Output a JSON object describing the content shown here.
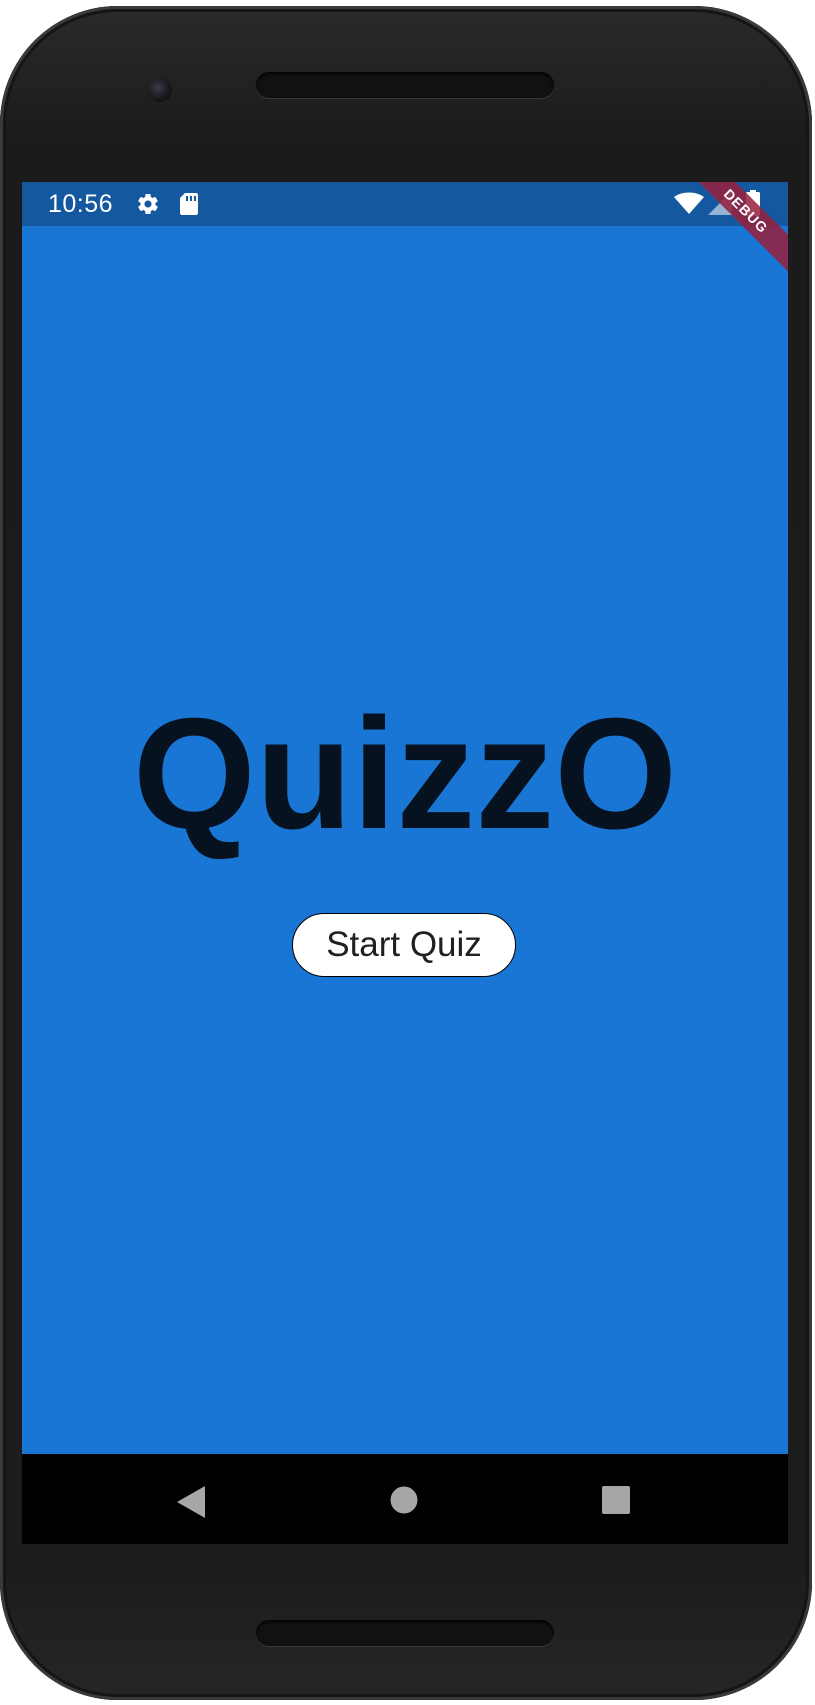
{
  "status_bar": {
    "time": "10:56",
    "icons": [
      "gear-icon",
      "sd-card-icon",
      "wifi-icon",
      "signal-icon",
      "battery-icon"
    ]
  },
  "debug_banner": {
    "label": "DEBUG"
  },
  "main": {
    "title": "QuizzO",
    "start_button_label": "Start Quiz"
  },
  "nav_bar": {
    "icons": [
      "back-icon",
      "home-icon",
      "recents-icon"
    ]
  },
  "colors": {
    "background": "#1976d4",
    "status_bar": "#1459a0",
    "title_text": "#06121f",
    "button_bg": "#ffffff",
    "debug_banner": "#961e3c"
  }
}
